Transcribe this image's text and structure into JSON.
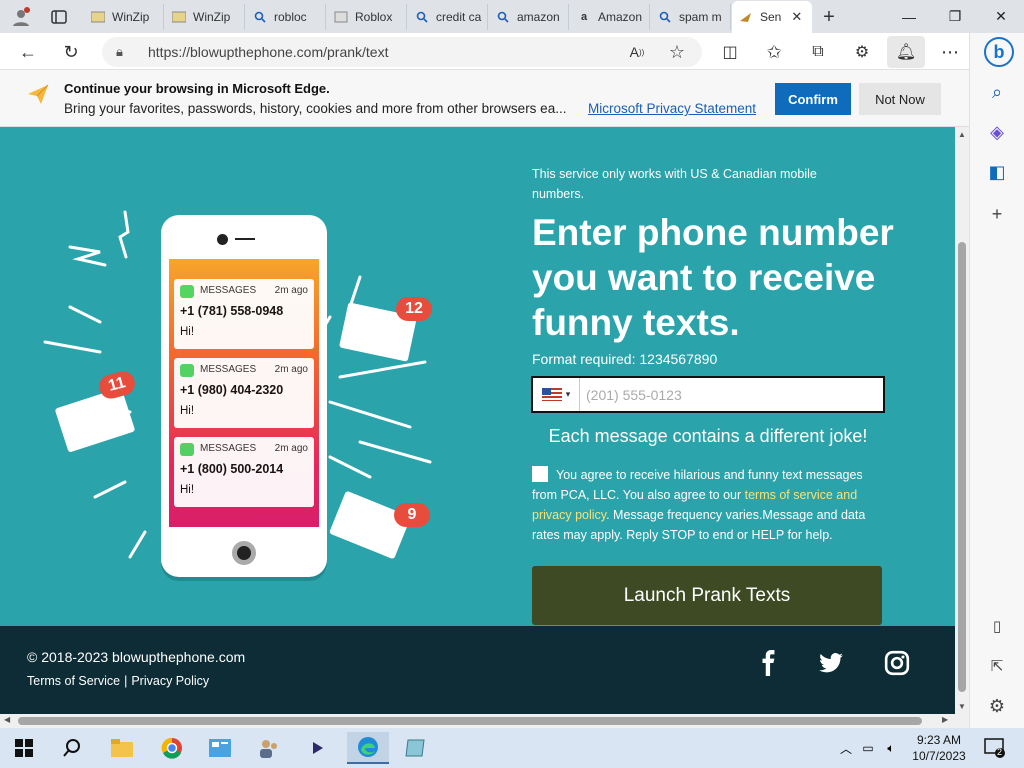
{
  "browser": {
    "tabs": [
      {
        "label": "WinZip",
        "icon": "winzip-icon"
      },
      {
        "label": "WinZip",
        "icon": "winzip-icon"
      },
      {
        "label": "robloc",
        "icon": "search-icon"
      },
      {
        "label": "Roblox",
        "icon": "roblox-icon"
      },
      {
        "label": "credit ca",
        "icon": "search-icon"
      },
      {
        "label": "amazon",
        "icon": "search-icon"
      },
      {
        "label": "Amazon",
        "icon": "amazon-icon"
      },
      {
        "label": "spam m",
        "icon": "search-icon"
      },
      {
        "label": "Sen",
        "icon": "prank-site-icon",
        "active": true
      }
    ],
    "url": "https://blowupthephone.com/prank/text",
    "notification": {
      "title": "Continue your browsing in Microsoft Edge.",
      "text": "Bring your favorites, passwords, history, cookies and more from other browsers ea...",
      "link": "Microsoft Privacy Statement",
      "confirm": "Confirm",
      "not_now": "Not Now"
    }
  },
  "page": {
    "notice": "This service only works with US & Canadian mobile numbers.",
    "headline": "Enter phone number you want to receive funny texts.",
    "format": "Format required: 1234567890",
    "phone_placeholder": "(201) 555-0123",
    "country_flag": "us-flag",
    "different_joke": "Each message contains a different joke!",
    "consent": {
      "part1": "You agree to receive hilarious and funny text messages from PCA, LLC. You also agree to our ",
      "link": "terms of service and privacy policy",
      "part2": ". Message frequency varies.Message and data rates may apply. Reply STOP to end or HELP for help."
    },
    "launch_button": "Launch Prank Texts",
    "illustration": {
      "messages": [
        {
          "app": "MESSAGES",
          "time": "2m ago",
          "number": "+1 (781) 558-0948",
          "body": "Hi!"
        },
        {
          "app": "MESSAGES",
          "time": "2m ago",
          "number": "+1 (980) 404-2320",
          "body": "Hi!"
        },
        {
          "app": "MESSAGES",
          "time": "2m ago",
          "number": "+1 (800) 500-2014",
          "body": "Hi!"
        }
      ],
      "badges": [
        "12",
        "11",
        "9"
      ]
    }
  },
  "footer": {
    "copyright": "© 2018-2023 blowupthephone.com",
    "terms": "Terms of Service",
    "sep": "|",
    "privacy": "Privacy Policy"
  },
  "taskbar": {
    "time": "9:23 AM",
    "date": "10/7/2023",
    "notif_count": "2"
  },
  "colors": {
    "page_bg": "#2aa3ab",
    "footer_bg": "#0d2c36",
    "launch_bg": "#3e4a23",
    "edge_blue": "#0f6cbd"
  }
}
